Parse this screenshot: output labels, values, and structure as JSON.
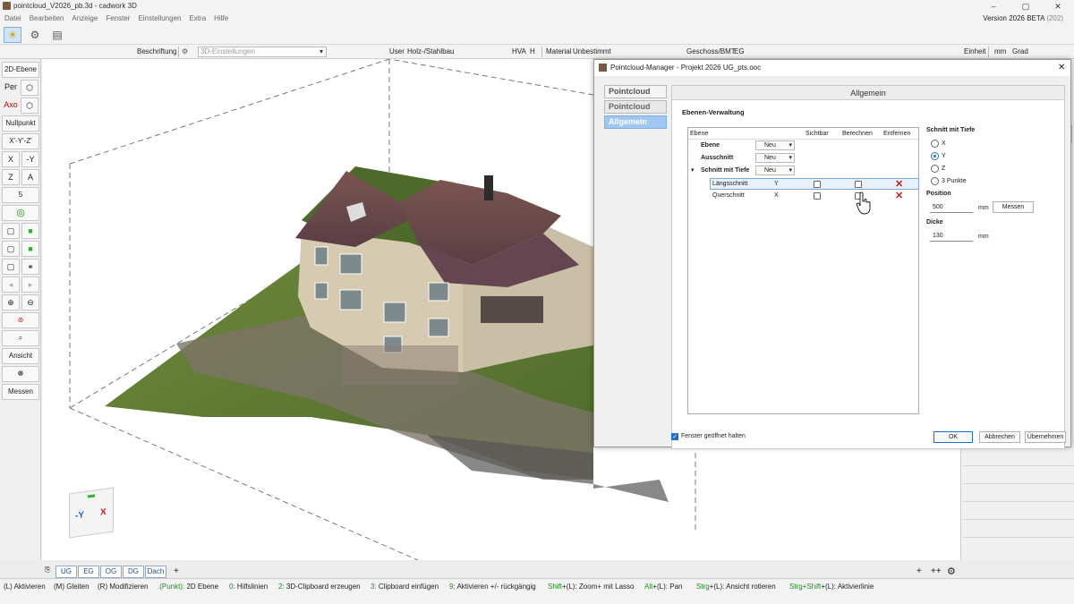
{
  "app": {
    "title": "pointcloud_V2026_pb.3d - cadwork 3D",
    "version": "Version 2026 BETA",
    "build": "(202)"
  },
  "menu": [
    "Datei",
    "Bearbeiten",
    "Anzeige",
    "Fenster",
    "Einstellungen",
    "Extra",
    "Hilfe"
  ],
  "toolbar2": {
    "beschriftung": "Beschriftung",
    "einstellungen_placeholder": "3D-Einstellungen",
    "user": "User",
    "user_value": "Holz-/Stahlbau",
    "hva": "HVA",
    "h": "H",
    "material": "Material",
    "material_value": "Unbestimmt",
    "geschoss": "Geschoss/BMT",
    "geschoss_value": "EG",
    "einheit": "Einheit",
    "mm": "mm",
    "grad": "Grad"
  },
  "left_tools": {
    "ebene2d": "2D-Ebene",
    "per": "Per",
    "axo": "Axo",
    "nullpunkt": "Nullpunkt",
    "xyz": "X'-Y'-Z'",
    "x": "X",
    "my": "-Y",
    "z": "Z",
    "a": "A",
    "five": "5",
    "ansicht": "Ansicht",
    "messen": "Messen"
  },
  "viewcube": {
    "left": "-Y",
    "right": "X"
  },
  "layer_tabs": [
    "UG",
    "EG",
    "OG",
    "DG",
    "Dach"
  ],
  "layer_tabs_add": "+",
  "bottom_right": {
    "plus": "+",
    "plusplus": "++"
  },
  "dialog": {
    "title": "Pointcloud-Manager - Projekt 2026 UG_pts.ooc",
    "close": "✕",
    "tabs": [
      "Pointcloud",
      "Pointcloud",
      "Allgemein"
    ],
    "header": "Allgemein",
    "section": "Ebenen-Verwaltung",
    "table": {
      "columns": [
        "Ebene",
        "Sichtbar",
        "Berechnen",
        "Entfernen"
      ],
      "groups": [
        {
          "label": "Ebene",
          "value": "Neu"
        },
        {
          "label": "Ausschnitt",
          "value": "Neu"
        },
        {
          "label": "Schnitt mit Tiefe",
          "value": "Neu"
        }
      ],
      "rows": [
        {
          "name": "Längsschnitt",
          "axis": "Y"
        },
        {
          "name": "Querschnitt",
          "axis": "X"
        }
      ]
    },
    "side": {
      "title": "Schnitt mit Tiefe",
      "options": [
        "X",
        "Y",
        "Z",
        "3 Punkte"
      ],
      "selected": "Y",
      "position_label": "Position",
      "position_value": "500",
      "position_unit": "mm",
      "messen": "Messen",
      "dicke_label": "Dicke",
      "dicke_value": "130",
      "dicke_unit": "mm"
    },
    "keep_open": "Fenster geöffnet halten",
    "buttons": {
      "ok": "OK",
      "cancel": "Abbrechen",
      "apply": "Übernehmen"
    }
  },
  "status": [
    {
      "k": "(L)",
      "t": "Aktivieren"
    },
    {
      "k": "(M)",
      "t": "Gleiten"
    },
    {
      "k": "(R)",
      "t": "Modifizieren"
    },
    {
      "k": ".(Punkt):",
      "t": "2D Ebene"
    },
    {
      "k": "0:",
      "t": "Hilfslinien"
    },
    {
      "k": "2:",
      "t": "3D-Clipboard erzeugen"
    },
    {
      "k": "3:",
      "t": "Clipboard einfügen"
    },
    {
      "k": "9:",
      "t": "Aktivieren +/- rückgängig"
    },
    {
      "k": "Shift",
      "t": "+(L): Zoom+ mit Lasso"
    },
    {
      "k": "Alt",
      "t": "+(L): Pan"
    },
    {
      "k": "Strg",
      "t": "+(L): Ansicht rotieren"
    },
    {
      "k": "Strg+Shift",
      "t": "+(L): Aktivierlinie"
    }
  ],
  "colors": {
    "accent": "#1f6fcf",
    "remove": "#d01818",
    "status_key": "#1c8d20"
  }
}
